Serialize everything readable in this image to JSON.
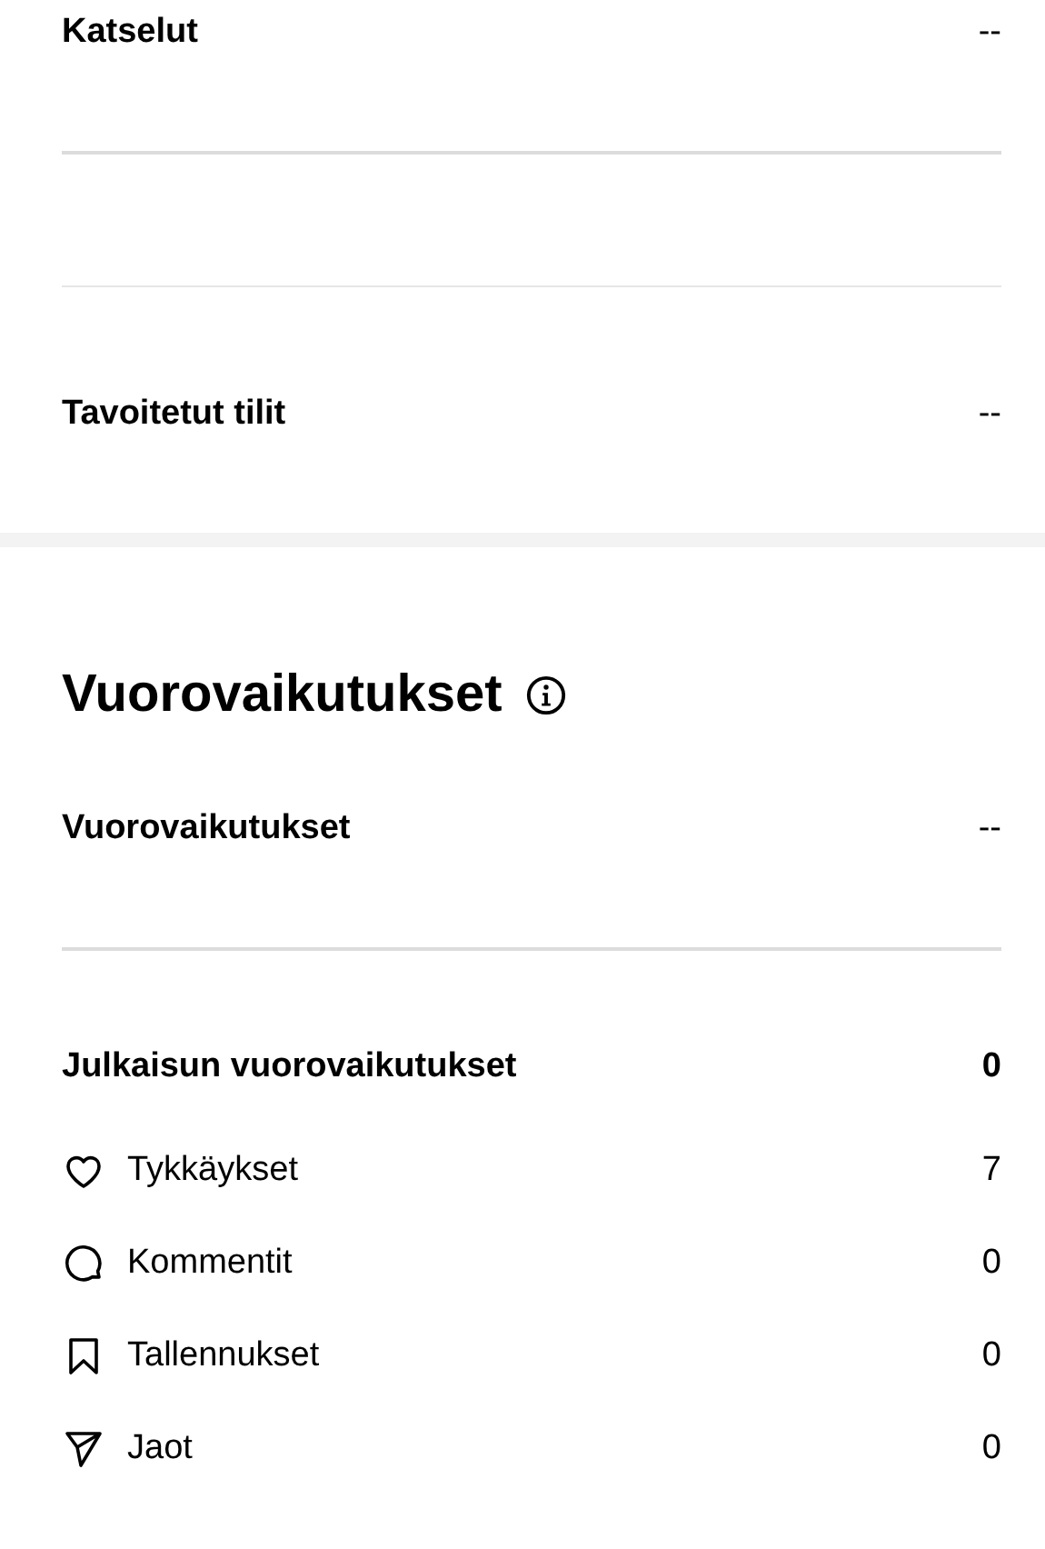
{
  "reach": {
    "rows": [
      {
        "label": "Katselut",
        "value": "--"
      },
      {
        "label": "Tavoitetut tilit",
        "value": "--"
      }
    ]
  },
  "interactions": {
    "title": "Vuorovaikutukset",
    "total": {
      "label": "Vuorovaikutukset",
      "value": "--"
    },
    "post": {
      "label": "Julkaisun vuorovaikutukset",
      "value": "0"
    },
    "items": [
      {
        "kind": "heart",
        "label": "Tykkäykset",
        "value": "7"
      },
      {
        "kind": "comment",
        "label": "Kommentit",
        "value": "0"
      },
      {
        "kind": "bookmark",
        "label": "Tallennukset",
        "value": "0"
      },
      {
        "kind": "send",
        "label": "Jaot",
        "value": "0"
      }
    ]
  }
}
